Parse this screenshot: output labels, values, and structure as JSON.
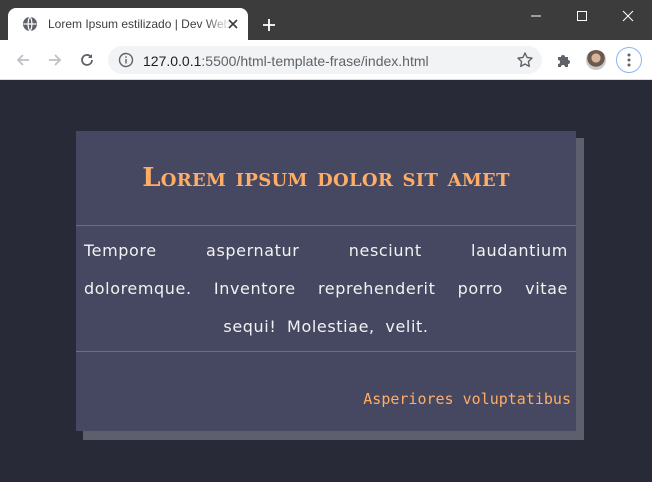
{
  "browser": {
    "tab_title": "Lorem Ipsum estilizado | Dev Web",
    "url_host": "127.0.0.1",
    "url_rest": ":5500/html-template-frase/index.html"
  },
  "icons": {
    "favicon": "globe-icon",
    "tab_close": "close-icon",
    "new_tab": "plus-icon",
    "minimize": "minimize-icon",
    "maximize": "maximize-icon",
    "close_window": "close-icon",
    "back": "arrow-left-icon",
    "forward": "arrow-right-icon",
    "reload": "reload-icon",
    "site_info": "info-icon",
    "bookmark": "star-icon",
    "extensions": "puzzle-icon",
    "profile": "avatar",
    "menu": "kebab-menu-icon"
  },
  "card": {
    "title": "Lorem ipsum dolor sit amet",
    "body": "Tempore aspernatur nesciunt laudantium doloremque. Inventore reprehenderit porro vitae sequi! Molestiae, velit.",
    "footer": "Asperiores voluptatibus"
  },
  "colors": {
    "page_background": "#292a37",
    "card_background": "#454860",
    "card_shadow": "#5d5f6e",
    "accent": "#ffad66",
    "body_text": "#f2f2f2"
  }
}
